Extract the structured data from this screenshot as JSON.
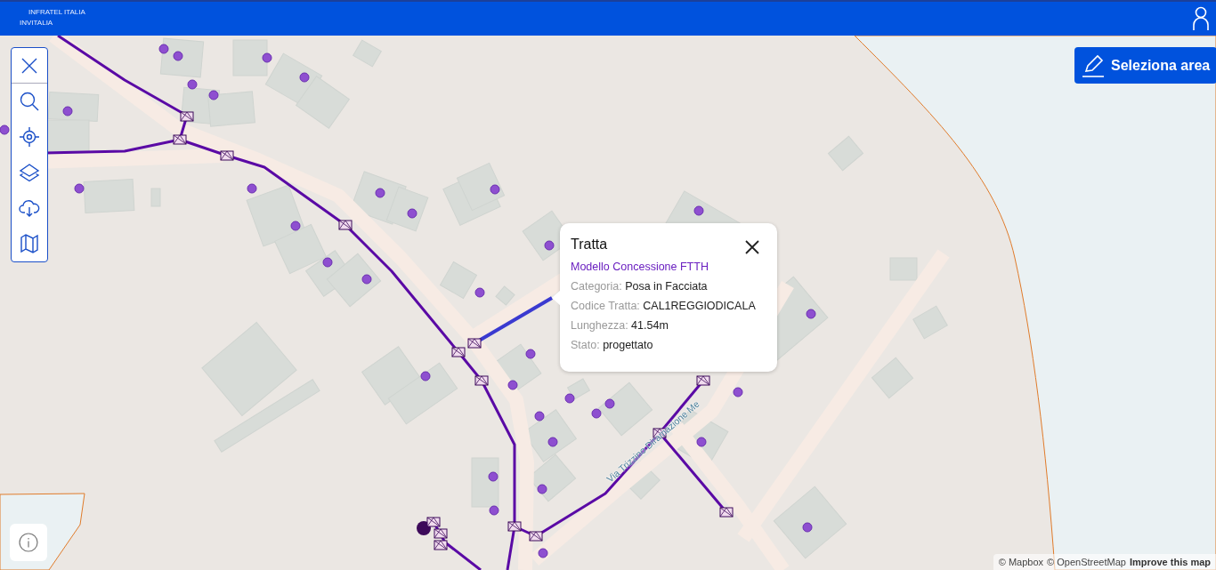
{
  "header": {
    "logo_top": "INFRATEL ITALIA",
    "logo_bottom": "INVITALIA"
  },
  "toolbar": [
    {
      "kind": "close"
    },
    {
      "kind": "search"
    },
    {
      "kind": "locate"
    },
    {
      "kind": "layers"
    },
    {
      "kind": "download"
    },
    {
      "kind": "map"
    }
  ],
  "select_area_button": {
    "label": "Seleziona area"
  },
  "popup": {
    "title": "Tratta",
    "subtitle": "Modello Concessione FTTH",
    "fields": [
      {
        "label": "Categoria:",
        "value": "Posa in Facciata"
      },
      {
        "label": "Codice Tratta:",
        "value": "CAL1REGGIODICALA"
      },
      {
        "label": "Lunghezza:",
        "value": "41.54m"
      },
      {
        "label": "Stato:",
        "value": "progettato"
      }
    ]
  },
  "road_label": "Via Trizzino Diramazione Me",
  "attribution": {
    "mapbox": "© Mapbox",
    "osm": "© OpenStreetMap",
    "improve": "Improve this map"
  }
}
